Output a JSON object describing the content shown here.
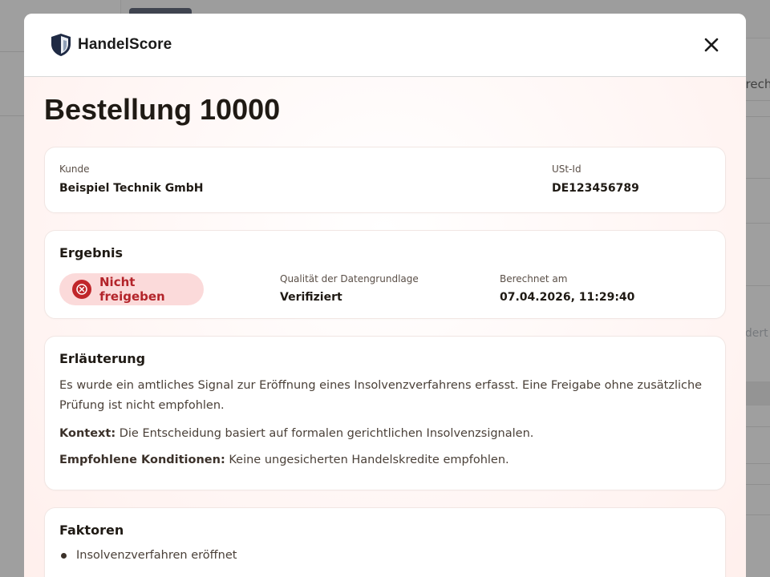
{
  "app": {
    "brand_name": "HandelScore"
  },
  "background": {
    "side_text_1": "prech",
    "side_text_2": "ndert"
  },
  "order": {
    "title": "Bestellung 10000"
  },
  "customer": {
    "customer_label": "Kunde",
    "customer_value": "Beispiel Technik GmbH",
    "vat_label": "USt-Id",
    "vat_value": "DE123456789"
  },
  "result": {
    "title": "Ergebnis",
    "badge_label": "Nicht freigeben",
    "quality_label": "Qualität der Datengrundlage",
    "quality_value": "Verifiziert",
    "computed_label": "Berechnet am",
    "computed_value": "07.04.2026, 11:29:40"
  },
  "explanation": {
    "title": "Erläuterung",
    "text": "Es wurde ein amtliches Signal zur Eröffnung eines Insolvenzverfahrens erfasst. Eine Freigabe ohne zusätzliche Prüfung ist nicht empfohlen.",
    "context_label": "Kontext:",
    "context_text": " Die Entscheidung basiert auf formalen gerichtlichen Insolvenzsignalen.",
    "conditions_label": "Empfohlene Konditionen:",
    "conditions_text": " Keine ungesicherten Handelskredite empfohlen."
  },
  "factors": {
    "title": "Faktoren",
    "items": [
      "Insolvenzverfahren eröffnet"
    ]
  },
  "colors": {
    "brand_dark": "#1f2a44",
    "danger": "#c0262a",
    "danger_bg": "#fbdada"
  },
  "icons": {
    "brand": "shield-logo-icon",
    "close": "close-icon",
    "badge": "x-circle-icon"
  }
}
